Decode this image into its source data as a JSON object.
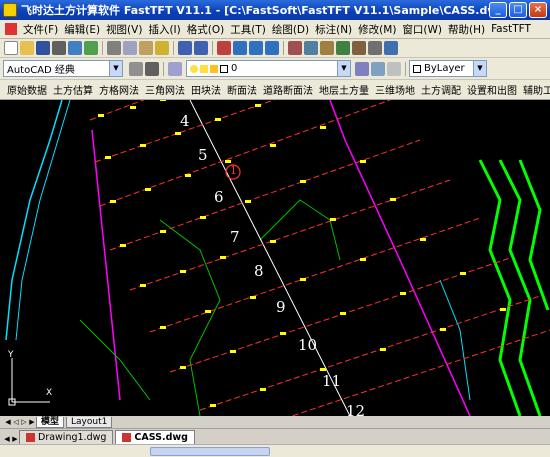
{
  "window": {
    "title": "飞时达土方计算软件 FastTFT V11.1 - [C:\\FastSoft\\FastTFT V11.1\\Sample\\CASS.dwg]",
    "min_label": "_",
    "max_label": "□",
    "close_label": "×"
  },
  "menu": [
    "文件(F)",
    "编辑(E)",
    "视图(V)",
    "插入(I)",
    "格式(O)",
    "工具(T)",
    "绘图(D)",
    "标注(N)",
    "修改(M)",
    "窗口(W)",
    "帮助(H)",
    "FastTFT"
  ],
  "toolbar2": {
    "workspace": "AutoCAD 经典",
    "layer": "0",
    "linetype": "ByLayer"
  },
  "commands": [
    "原始数据",
    "土方估算",
    "方格网法",
    "三角网法",
    "田块法",
    "断面法",
    "道路断面法",
    "地层土方量",
    "三维场地",
    "土方调配",
    "设置和出图",
    "辅助工具"
  ],
  "drawing": {
    "section_labels": [
      "4",
      "5",
      "1",
      "6",
      "7",
      "8",
      "9",
      "10",
      "11",
      "12"
    ],
    "ucs": {
      "x": "X",
      "y": "Y"
    }
  },
  "layout_tabs": [
    "模型",
    "Layout1"
  ],
  "doc_tabs": [
    "Drawing1.dwg",
    "CASS.dwg"
  ],
  "colors": {
    "accent": "#0a3fb8",
    "canvas": "#000000",
    "section_line": "#ff3333",
    "marker": "#ffff00",
    "contour": "#00cc00",
    "boundary": "#ff00ff",
    "river": "#00ffff"
  }
}
